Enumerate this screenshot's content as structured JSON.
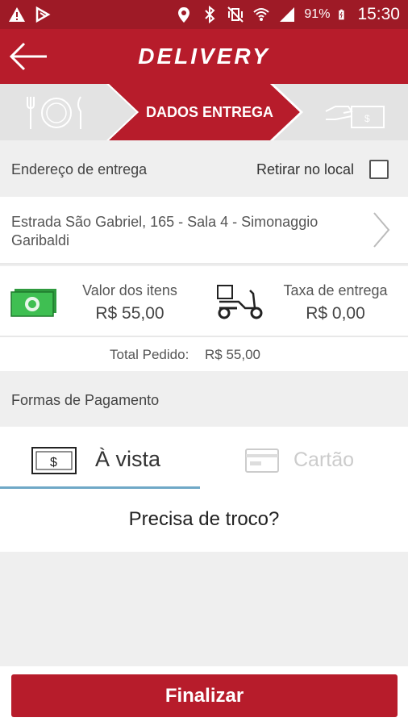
{
  "status_bar": {
    "battery": "91%",
    "time": "15:30"
  },
  "app_bar": {
    "title": "DELIVERY"
  },
  "steps": {
    "active_label": "DADOS ENTREGA"
  },
  "address_section": {
    "header": "Endereço de entrega",
    "pickup_label": "Retirar no local",
    "pickup_checked": false,
    "address": "Estrada São Gabriel, 165 - Sala 4 - Simonaggio Garibaldi"
  },
  "values": {
    "items_label": "Valor dos itens",
    "items_value": "R$ 55,00",
    "fee_label": "Taxa de entrega",
    "fee_value": "R$ 0,00",
    "total_label": "Total Pedido:",
    "total_value": "R$ 55,00"
  },
  "payment": {
    "header": "Formas de Pagamento",
    "tab_cash": "À vista",
    "tab_card": "Cartão",
    "change_question": "Precisa de troco?"
  },
  "footer": {
    "finish_label": "Finalizar"
  },
  "colors": {
    "primary": "#b71c2b",
    "status_bar": "#9e1a26",
    "tab_indicator": "#6fa8c7",
    "background": "#efefef"
  }
}
